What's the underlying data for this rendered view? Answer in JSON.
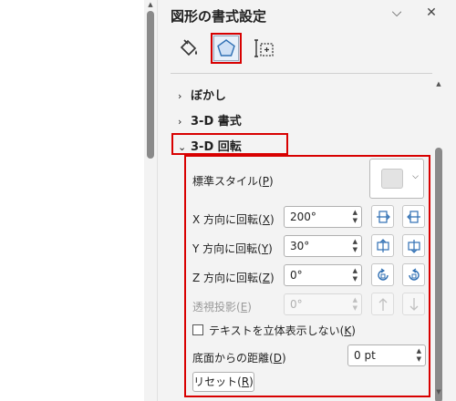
{
  "pane": {
    "title": "図形の書式設定",
    "dropdown_glyph": "⌵",
    "close_glyph": "✕"
  },
  "tabs": [
    {
      "name": "fill-line-icon",
      "active": false
    },
    {
      "name": "effects-icon",
      "active": true
    },
    {
      "name": "size-properties-icon",
      "active": false
    }
  ],
  "sections": {
    "blur": {
      "label": "ぼかし",
      "chevron": "›"
    },
    "format3d": {
      "label": "3-D 書式",
      "chevron": "›"
    },
    "rotation3d": {
      "label": "3-D 回転",
      "chevron": "⌄"
    }
  },
  "rotation": {
    "preset_label_pre": "標準スタイル(",
    "preset_key": "P",
    "preset_label_post": ")",
    "x": {
      "label_pre": "X 方向に回転(",
      "key": "X",
      "label_post": ")",
      "value": "200°"
    },
    "y": {
      "label_pre": "Y 方向に回転(",
      "key": "Y",
      "label_post": ")",
      "value": "30°"
    },
    "z": {
      "label_pre": "Z 方向に回転(",
      "key": "Z",
      "label_post": ")",
      "value": "0°"
    },
    "perspective": {
      "label_pre": "透視投影(",
      "key": "E",
      "label_post": ")",
      "value": "0°"
    },
    "keep_flat": {
      "label_pre": "テキストを立体表示しない(",
      "key": "K",
      "label_post": ")",
      "checked": false
    },
    "distance": {
      "label_pre": "底面からの距離(",
      "key": "D",
      "label_post": ")",
      "value": "0 pt"
    },
    "reset": {
      "label_pre": "リセット(",
      "key": "R",
      "label_post": ")"
    }
  },
  "colors": {
    "highlight": "#d80000",
    "icon_blue": "#2f6fb3"
  }
}
